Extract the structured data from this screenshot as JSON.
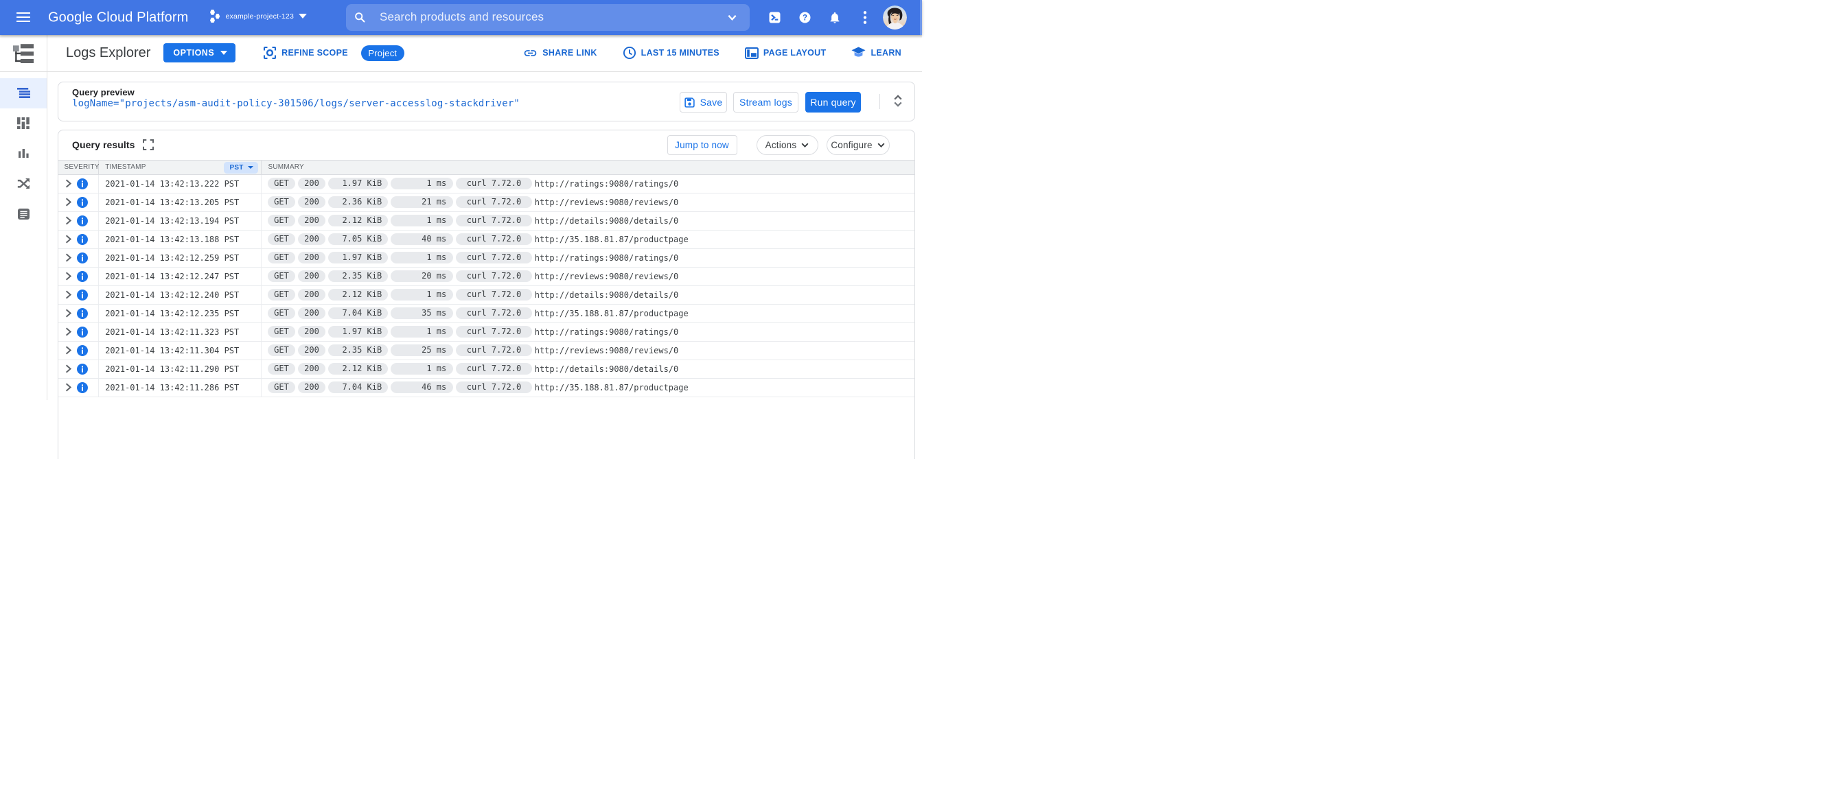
{
  "topbar": {
    "product_name": "Google Cloud Platform",
    "project_name": "example-project-123",
    "search_placeholder": "Search products and resources",
    "icons": [
      "hamburger-icon",
      "project-hexagons-icon",
      "search-icon",
      "chevron-down-icon",
      "cloud-shell-icon",
      "help-icon",
      "notifications-icon",
      "more-vert-icon",
      "avatar"
    ]
  },
  "toolbar": {
    "page_title": "Logs Explorer",
    "options_label": "OPTIONS",
    "refine_scope_label": "REFINE SCOPE",
    "scope_badge": "Project",
    "share_link_label": "SHARE LINK",
    "time_range_label": "LAST 15 MINUTES",
    "page_layout_label": "PAGE LAYOUT",
    "learn_label": "LEARN"
  },
  "sidebar": {
    "items": [
      {
        "label": "Logs Explorer",
        "icon": "logs-explorer-icon",
        "active": true
      },
      {
        "label": "Logs Dashboard",
        "icon": "logs-dashboard-icon",
        "active": false
      },
      {
        "label": "Logs-based Metrics",
        "icon": "logs-metrics-icon",
        "active": false
      },
      {
        "label": "Logs Router",
        "icon": "logs-router-icon",
        "active": false
      },
      {
        "label": "Logs Storage",
        "icon": "logs-storage-icon",
        "active": false
      }
    ]
  },
  "query_preview": {
    "label": "Query preview",
    "query": "logName=\"projects/asm-audit-policy-301506/logs/server-accesslog-stackdriver\"",
    "save_label": "Save",
    "stream_logs_label": "Stream logs",
    "run_query_label": "Run query"
  },
  "results": {
    "title": "Query results",
    "jump_to_now_label": "Jump to now",
    "actions_label": "Actions",
    "configure_label": "Configure",
    "columns": {
      "severity": "SEVERITY",
      "timestamp": "TIMESTAMP",
      "timezone": "PST",
      "summary": "SUMMARY"
    },
    "severity_level": "Info",
    "rows": [
      {
        "time": "2021-01-14 13:42:13.222 PST",
        "method": "GET",
        "status": "200",
        "size": "1.97 KiB",
        "latency": "1 ms",
        "agent": "curl 7.72.0",
        "url": "http://ratings:9080/ratings/0"
      },
      {
        "time": "2021-01-14 13:42:13.205 PST",
        "method": "GET",
        "status": "200",
        "size": "2.36 KiB",
        "latency": "21 ms",
        "agent": "curl 7.72.0",
        "url": "http://reviews:9080/reviews/0"
      },
      {
        "time": "2021-01-14 13:42:13.194 PST",
        "method": "GET",
        "status": "200",
        "size": "2.12 KiB",
        "latency": "1 ms",
        "agent": "curl 7.72.0",
        "url": "http://details:9080/details/0"
      },
      {
        "time": "2021-01-14 13:42:13.188 PST",
        "method": "GET",
        "status": "200",
        "size": "7.05 KiB",
        "latency": "40 ms",
        "agent": "curl 7.72.0",
        "url": "http://35.188.81.87/productpage"
      },
      {
        "time": "2021-01-14 13:42:12.259 PST",
        "method": "GET",
        "status": "200",
        "size": "1.97 KiB",
        "latency": "1 ms",
        "agent": "curl 7.72.0",
        "url": "http://ratings:9080/ratings/0"
      },
      {
        "time": "2021-01-14 13:42:12.247 PST",
        "method": "GET",
        "status": "200",
        "size": "2.35 KiB",
        "latency": "20 ms",
        "agent": "curl 7.72.0",
        "url": "http://reviews:9080/reviews/0"
      },
      {
        "time": "2021-01-14 13:42:12.240 PST",
        "method": "GET",
        "status": "200",
        "size": "2.12 KiB",
        "latency": "1 ms",
        "agent": "curl 7.72.0",
        "url": "http://details:9080/details/0"
      },
      {
        "time": "2021-01-14 13:42:12.235 PST",
        "method": "GET",
        "status": "200",
        "size": "7.04 KiB",
        "latency": "35 ms",
        "agent": "curl 7.72.0",
        "url": "http://35.188.81.87/productpage"
      },
      {
        "time": "2021-01-14 13:42:11.323 PST",
        "method": "GET",
        "status": "200",
        "size": "1.97 KiB",
        "latency": "1 ms",
        "agent": "curl 7.72.0",
        "url": "http://ratings:9080/ratings/0"
      },
      {
        "time": "2021-01-14 13:42:11.304 PST",
        "method": "GET",
        "status": "200",
        "size": "2.35 KiB",
        "latency": "25 ms",
        "agent": "curl 7.72.0",
        "url": "http://reviews:9080/reviews/0"
      },
      {
        "time": "2021-01-14 13:42:11.290 PST",
        "method": "GET",
        "status": "200",
        "size": "2.12 KiB",
        "latency": "1 ms",
        "agent": "curl 7.72.0",
        "url": "http://details:9080/details/0"
      },
      {
        "time": "2021-01-14 13:42:11.286 PST",
        "method": "GET",
        "status": "200",
        "size": "7.04 KiB",
        "latency": "46 ms",
        "agent": "curl 7.72.0",
        "url": "http://35.188.81.87/productpage"
      }
    ]
  },
  "colors": {
    "header_blue": "#4176e4",
    "button_blue": "#1a73e8",
    "link_blue": "#1967d2",
    "active_item_bg": "#e8f0fe",
    "pst_pill_bg": "#d2e3fc",
    "pill_gray": "#e8eaed",
    "table_head_bg": "#f1f3f4",
    "border_gray": "#dadce0",
    "text_dark": "#202124",
    "text_gray": "#5f6368",
    "text_body": "#3c4043"
  }
}
